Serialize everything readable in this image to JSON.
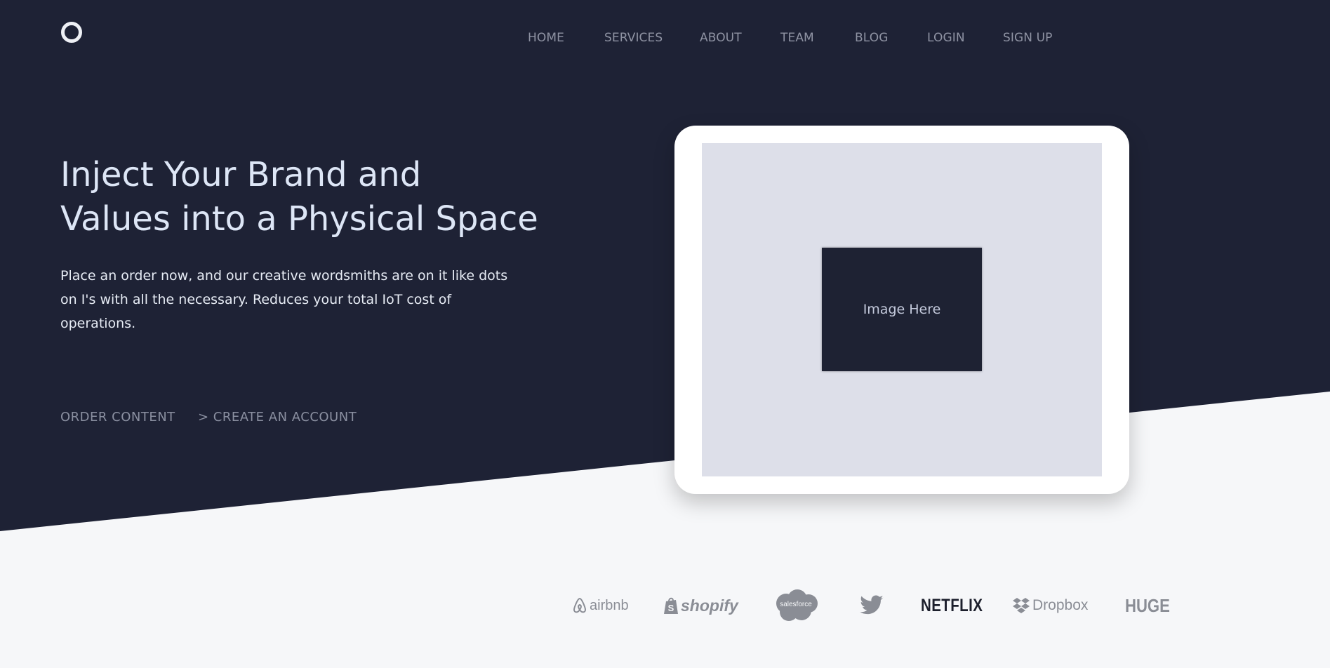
{
  "nav": {
    "items": [
      {
        "label": "HOME"
      },
      {
        "label": "SERVICES"
      },
      {
        "label": "ABOUT"
      },
      {
        "label": "TEAM"
      },
      {
        "label": "BLOG"
      },
      {
        "label": "LOGIN"
      },
      {
        "label": "SIGN UP"
      }
    ]
  },
  "hero": {
    "headline_line1": "Inject Your Brand and",
    "headline_line2": "Values into a Physical Space",
    "lead": "Place an order now, and our creative wordsmiths are on it like dots on I's with all the necessary. Reduces your total IoT cost of operations.",
    "cta_primary": "ORDER CONTENT",
    "cta_secondary": "> CREATE AN ACCOUNT",
    "image_placeholder": "Image Here"
  },
  "clients": [
    {
      "name": "airbnb",
      "icon": "airbnb-logo"
    },
    {
      "name": "shopify",
      "icon": "shopify-logo"
    },
    {
      "name": "salesforce",
      "icon": "salesforce-logo"
    },
    {
      "name": "",
      "icon": "twitter-logo"
    },
    {
      "name": "NETFLIX",
      "icon": "netflix-logo"
    },
    {
      "name": "Dropbox",
      "icon": "dropbox-logo"
    },
    {
      "name": "HUGE",
      "icon": "huge-logo"
    }
  ],
  "colors": {
    "hero_bg": "#1e2235",
    "page_bg": "#f6f7f9",
    "headline": "#dde6f6",
    "nav_text": "#8f93a3",
    "screen_bg": "#dddfe9",
    "placeholder_bg": "#1e2233"
  }
}
